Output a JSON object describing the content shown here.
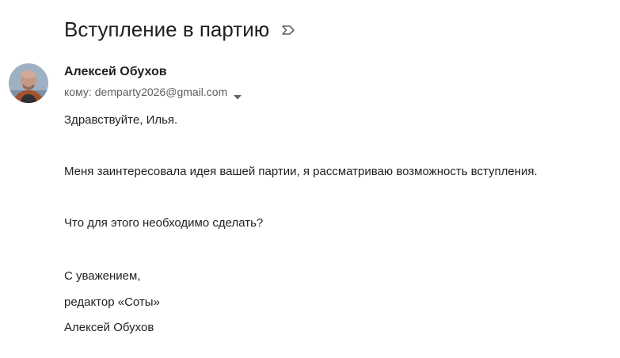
{
  "email": {
    "subject": "Вступление в партию",
    "important_icon": "importance-marker-icon",
    "sender": {
      "name": "Алексей Обухов",
      "avatar": "sender-avatar-photo"
    },
    "recipient": {
      "label": "кому:",
      "address": "demparty2026@gmail.com",
      "expand_icon": "caret-down-icon"
    },
    "body": {
      "greeting": "Здравствуйте, Илья.",
      "paragraph_1": "Меня заинтересовала идея вашей партии, я рассматриваю возможность вступления.",
      "paragraph_2": "Что для этого необходимо сделать?",
      "closing": "С уважением,",
      "signature_title": "редактор «Соты»",
      "signature_name": "Алексей Обухов"
    }
  },
  "colors": {
    "text_primary": "#1f1f1f",
    "text_secondary": "#5e5e5e",
    "icon": "#5f6368",
    "background": "#ffffff"
  }
}
